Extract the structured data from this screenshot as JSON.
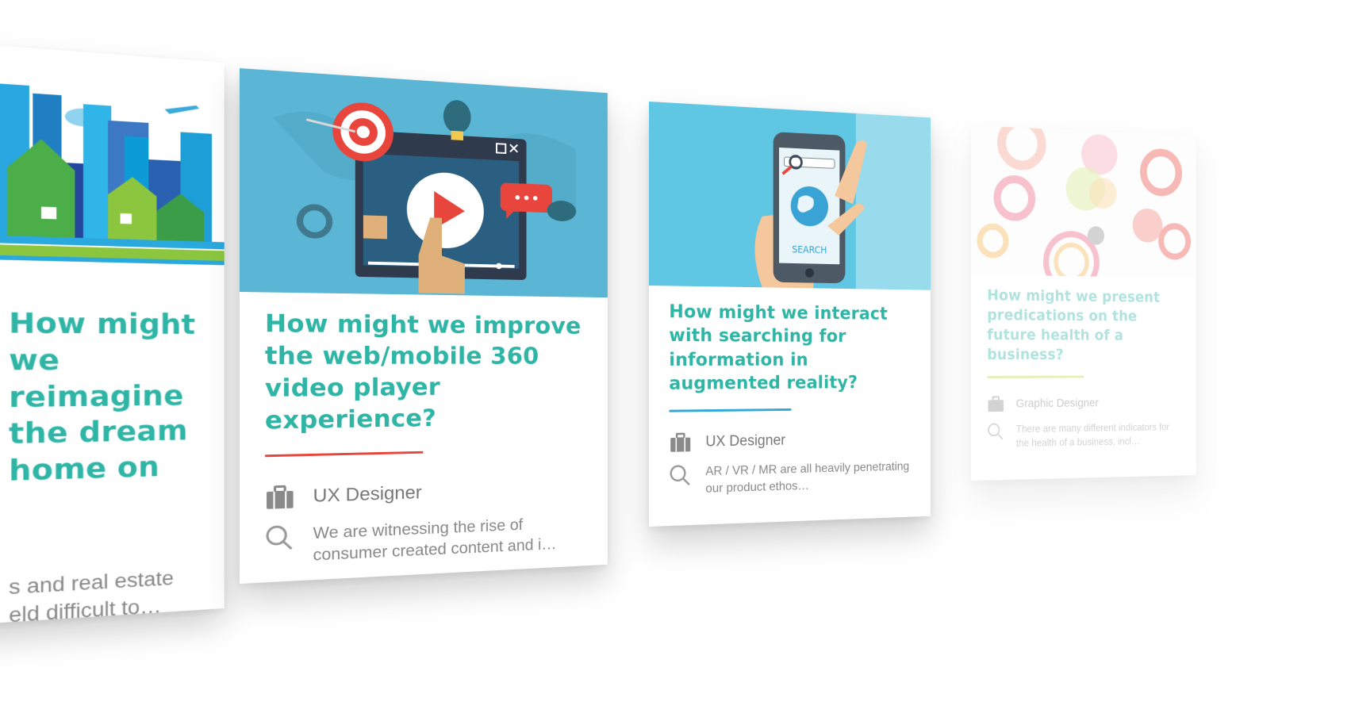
{
  "cards": [
    {
      "title": "How might we reimagine the dream home on",
      "underline_color": "#e8453c",
      "role": "",
      "description": "s and real estate\neld difficult to…",
      "image_icon": "city-skyline-illustration"
    },
    {
      "title": "How might we improve the web/mobile 360 video player experience?",
      "underline_color": "#e8453c",
      "role": "UX Designer",
      "description": "We are witnessing the rise of consumer created content and i…",
      "image_icon": "video-player-illustration"
    },
    {
      "title": "How might we interact with searching for information in augmented reality?",
      "underline_color": "#35a9d6",
      "role": "UX Designer",
      "description": "AR / VR / MR are all heavily penetrating our product ethos…",
      "image_icon": "phone-search-illustration",
      "image_label": "SEARCH"
    },
    {
      "title": "How might we present predications on the future health of a business?",
      "underline_color": "#b9d83f",
      "role": "Graphic Designer",
      "description": "There are many different indicators for the health of a business, incl…",
      "image_icon": "pie-charts-illustration"
    }
  ],
  "colors": {
    "title": "#2fb5a6",
    "meta_text": "#777777"
  },
  "icons": {
    "role": "briefcase-icon",
    "description": "search-icon"
  }
}
